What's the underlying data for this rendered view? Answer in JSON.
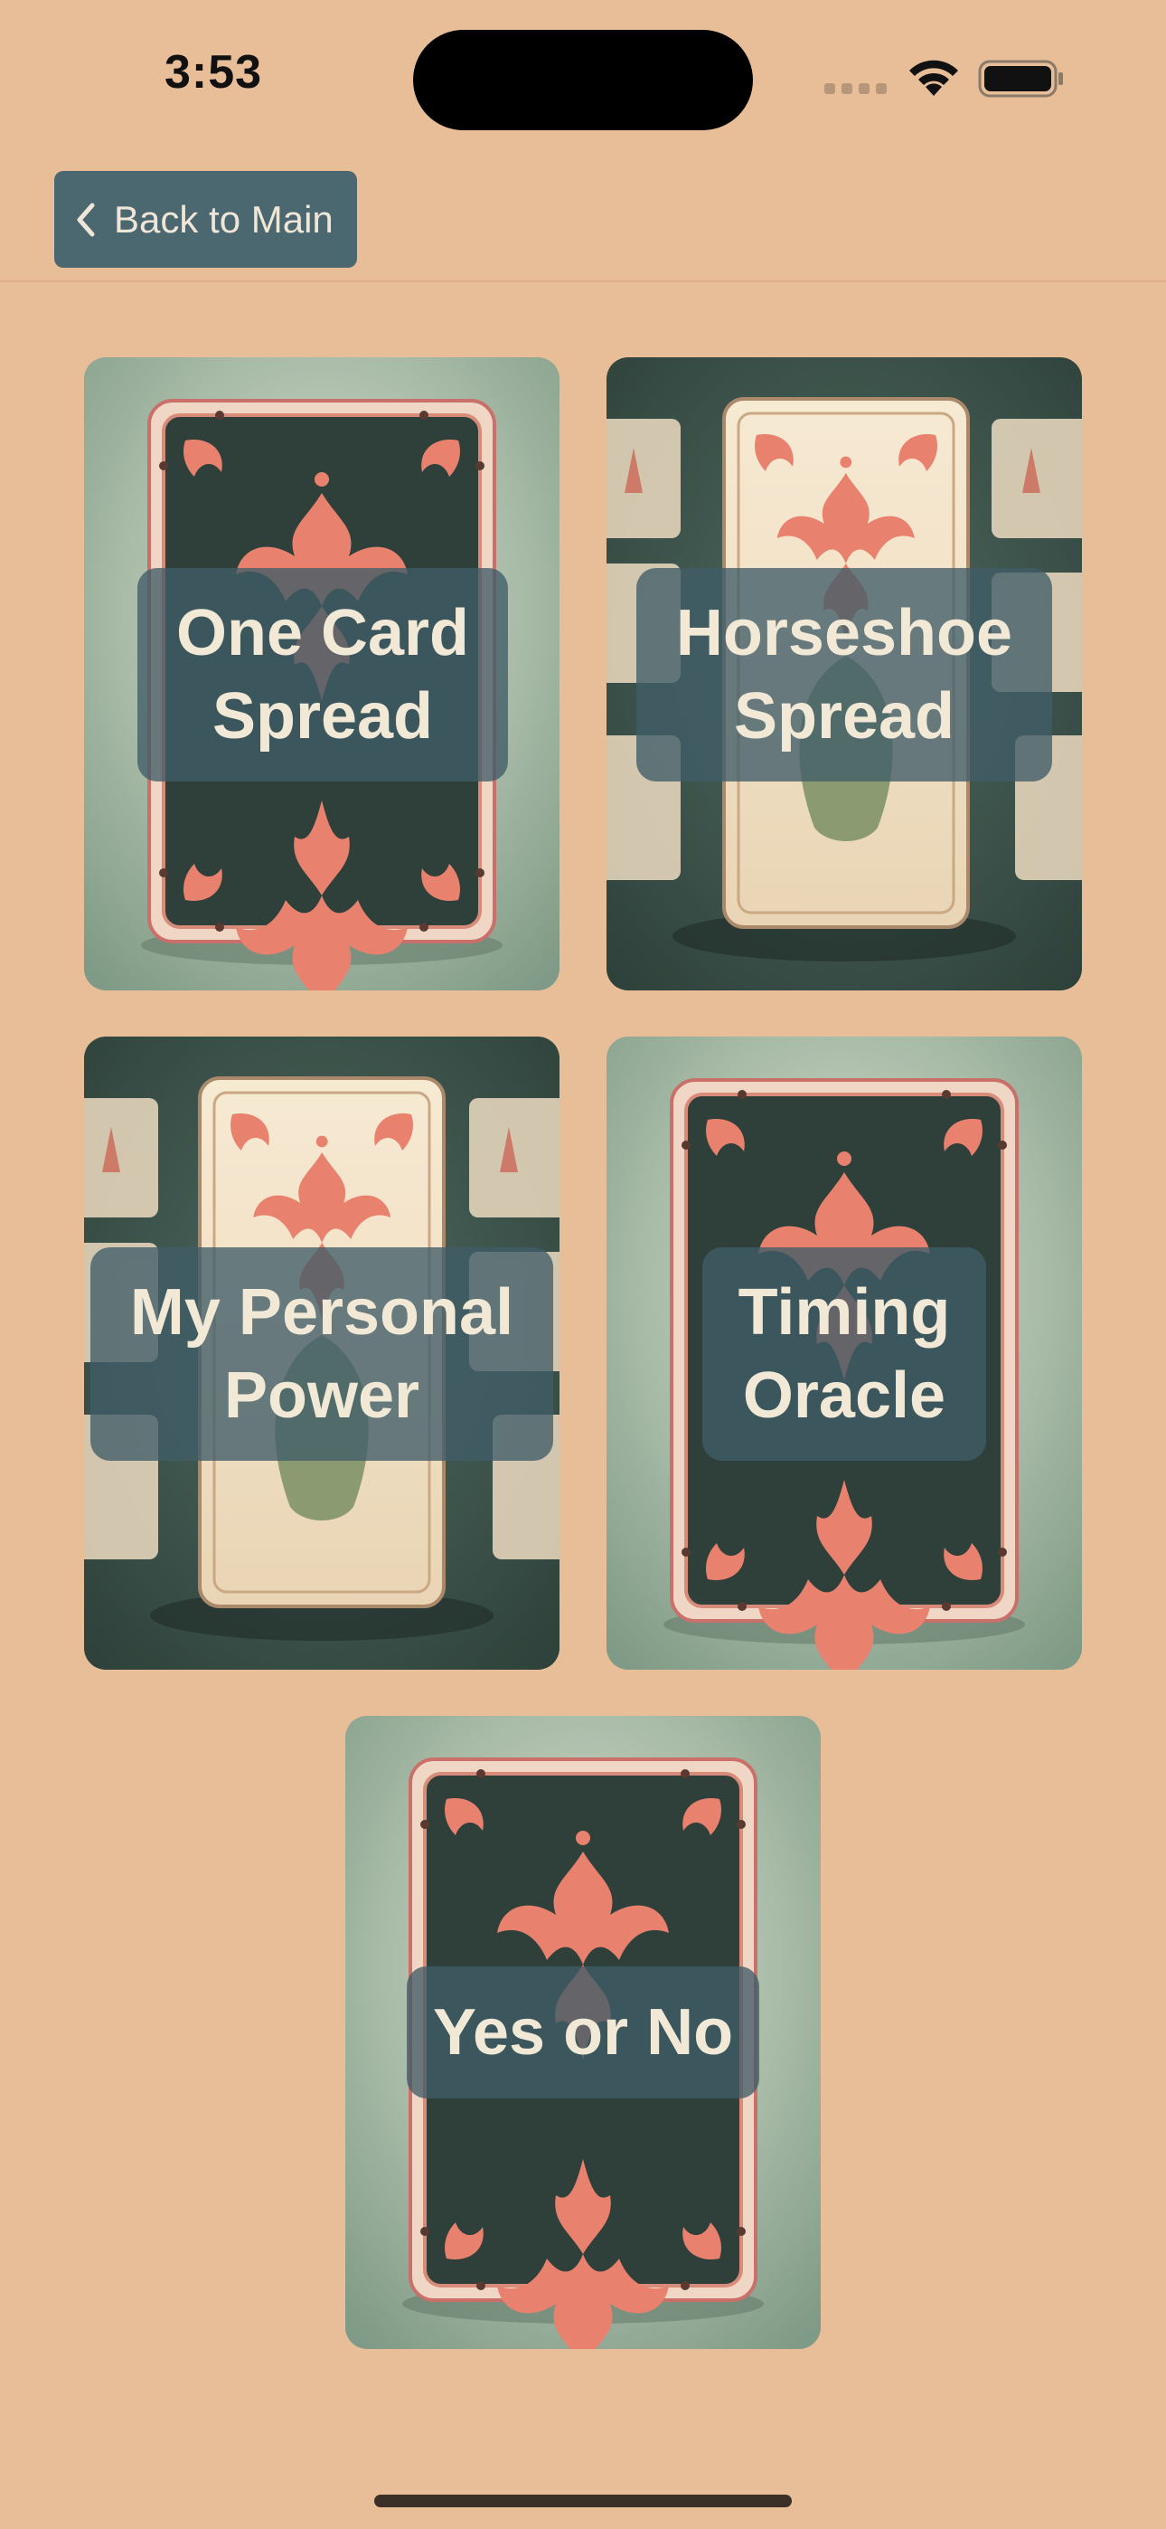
{
  "status_bar": {
    "time": "3:53"
  },
  "nav": {
    "back_label": "Back to Main"
  },
  "spreads": [
    {
      "label": "One Card Spread",
      "line1": "One Card",
      "line2": "Spread",
      "art": "dark-card-back-art"
    },
    {
      "label": "Horseshoe Spread",
      "line1": "Horseshoe",
      "line2": "Spread",
      "art": "cream-card-front-art"
    },
    {
      "label": "My Personal Power",
      "line1": "My Personal",
      "line2": "Power",
      "art": "cream-card-front-art"
    },
    {
      "label": "Timing Oracle",
      "line1": "Timing",
      "line2": "Oracle",
      "art": "dark-card-back-art"
    },
    {
      "label": "Yes or No",
      "line1": "Yes or No",
      "art": "dark-card-back-art"
    }
  ],
  "colors": {
    "background": "#E8BE98",
    "button": "#4B6770",
    "label_overlay": "#405C68",
    "card_dark": "#2F3F3A",
    "card_ornament": "#E8826E",
    "card_cream": "#F2E2C8"
  }
}
